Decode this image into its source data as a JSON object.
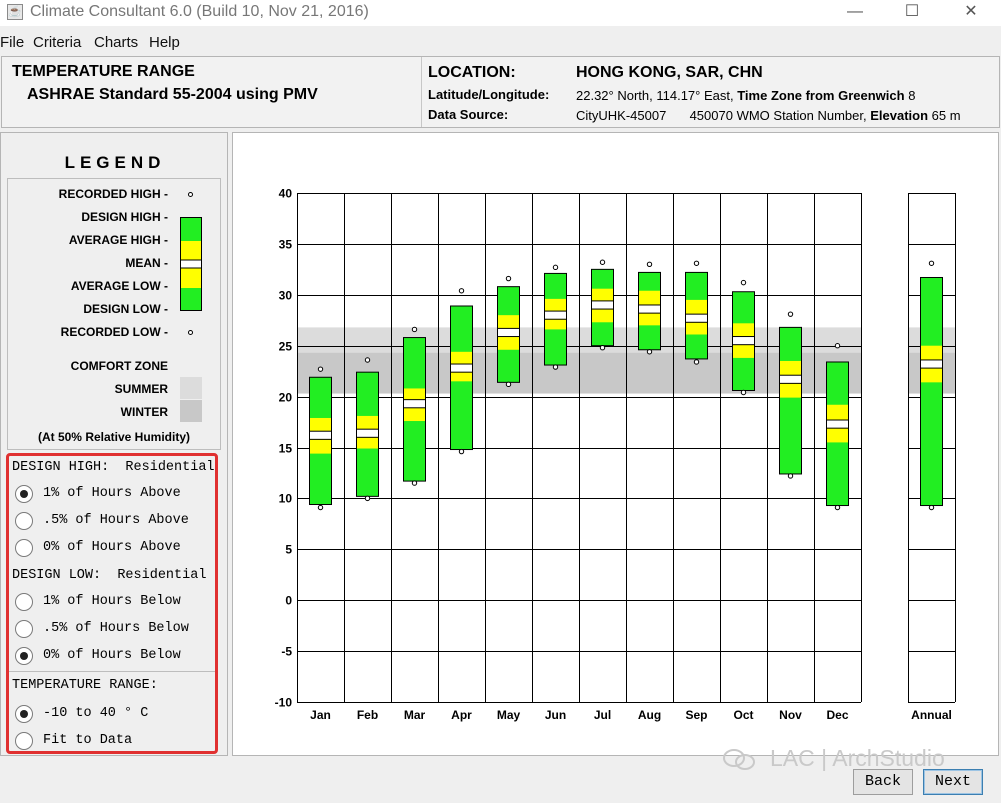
{
  "window": {
    "title": "Climate Consultant 6.0 (Build 10, Nov 21, 2016)",
    "controls": [
      "—",
      "☐",
      "✕"
    ]
  },
  "menu": [
    "File",
    "Criteria",
    "Charts",
    "Help"
  ],
  "header": {
    "chart_title": "TEMPERATURE RANGE",
    "chart_subtitle": "ASHRAE Standard 55-2004 using PMV",
    "location_label": "LOCATION:",
    "location_value": "HONG KONG, SAR, CHN",
    "latlon_label": "Latitude/Longitude:",
    "latlon_value": "22.32° North, 114.17° East,",
    "timezone_label": "Time Zone from Greenwich",
    "timezone_value": "8",
    "source_label": "Data Source:",
    "source_value": "CityUHK-45007",
    "station_value": "450070 WMO Station Number,",
    "elevation_label": "Elevation",
    "elevation_value": "65 m"
  },
  "legend": {
    "title": "LEGEND",
    "items": [
      "RECORDED HIGH -",
      "DESIGN HIGH -",
      "AVERAGE HIGH -",
      "MEAN -",
      "AVERAGE LOW -",
      "DESIGN LOW -",
      "RECORDED LOW -"
    ],
    "comfort_title": "COMFORT ZONE",
    "summer_label": "SUMMER",
    "winter_label": "WINTER",
    "note": "(At 50% Relative Humidity)",
    "colors": {
      "design_band": "#22ee22",
      "average_band": "#ffff00",
      "summer_zone": "#dcdcdc",
      "winter_zone": "#c8c8c8"
    }
  },
  "options": {
    "design_high_header": "DESIGN HIGH:  Residential",
    "design_high": [
      {
        "label": "1% of Hours Above",
        "selected": true
      },
      {
        "label": ".5% of Hours Above",
        "selected": false
      },
      {
        "label": "0% of Hours Above",
        "selected": false
      }
    ],
    "design_low_header": "DESIGN LOW:  Residential",
    "design_low": [
      {
        "label": "1% of Hours Below",
        "selected": false
      },
      {
        "label": ".5% of Hours Below",
        "selected": false
      },
      {
        "label": "0% of Hours Below",
        "selected": true
      }
    ],
    "range_header": "TEMPERATURE RANGE:",
    "range": [
      {
        "label": "-10 to 40 ° C",
        "selected": true
      },
      {
        "label": "Fit to Data",
        "selected": false
      }
    ]
  },
  "chart_data": {
    "type": "bar",
    "categories": [
      "Jan",
      "Feb",
      "Mar",
      "Apr",
      "May",
      "Jun",
      "Jul",
      "Aug",
      "Sep",
      "Oct",
      "Nov",
      "Dec",
      "Annual"
    ],
    "ylim": [
      -10,
      40
    ],
    "yticks": [
      40,
      35,
      30,
      25,
      20,
      15,
      10,
      5,
      0,
      -5,
      -10
    ],
    "grid": true,
    "comfort_zones": {
      "summer": [
        20.3,
        26.8
      ],
      "winter": [
        20.3,
        24.3
      ]
    },
    "data": [
      {
        "recorded_high": 22.5,
        "design_high": 21.9,
        "average_high": 17.9,
        "mean": 16.2,
        "average_low": 14.4,
        "design_low": 9.4,
        "recorded_low": 9.3
      },
      {
        "recorded_high": 23.4,
        "design_high": 22.4,
        "average_high": 18.1,
        "mean": 16.4,
        "average_low": 14.9,
        "design_low": 10.2,
        "recorded_low": 10.2
      },
      {
        "recorded_high": 26.4,
        "design_high": 25.8,
        "average_high": 20.8,
        "mean": 19.3,
        "average_low": 17.6,
        "design_low": 11.7,
        "recorded_low": 11.7
      },
      {
        "recorded_high": 30.2,
        "design_high": 28.9,
        "average_high": 24.4,
        "mean": 22.8,
        "average_low": 21.5,
        "design_low": 14.8,
        "recorded_low": 14.8
      },
      {
        "recorded_high": 31.4,
        "design_high": 30.8,
        "average_high": 28.0,
        "mean": 26.3,
        "average_low": 24.6,
        "design_low": 21.4,
        "recorded_low": 21.4
      },
      {
        "recorded_high": 32.5,
        "design_high": 32.1,
        "average_high": 29.6,
        "mean": 28.0,
        "average_low": 26.6,
        "design_low": 23.1,
        "recorded_low": 23.1
      },
      {
        "recorded_high": 33.0,
        "design_high": 32.5,
        "average_high": 30.6,
        "mean": 29.0,
        "average_low": 27.3,
        "design_low": 25.0,
        "recorded_low": 25.0
      },
      {
        "recorded_high": 32.8,
        "design_high": 32.2,
        "average_high": 30.4,
        "mean": 28.6,
        "average_low": 27.0,
        "design_low": 24.6,
        "recorded_low": 24.6
      },
      {
        "recorded_high": 32.9,
        "design_high": 32.2,
        "average_high": 29.5,
        "mean": 27.7,
        "average_low": 26.1,
        "design_low": 23.7,
        "recorded_low": 23.6
      },
      {
        "recorded_high": 31.0,
        "design_high": 30.3,
        "average_high": 27.2,
        "mean": 25.5,
        "average_low": 23.8,
        "design_low": 20.6,
        "recorded_low": 20.6
      },
      {
        "recorded_high": 27.9,
        "design_high": 26.8,
        "average_high": 23.5,
        "mean": 21.7,
        "average_low": 19.9,
        "design_low": 12.4,
        "recorded_low": 12.4
      },
      {
        "recorded_high": 24.8,
        "design_high": 23.4,
        "average_high": 19.2,
        "mean": 17.3,
        "average_low": 15.5,
        "design_low": 9.3,
        "recorded_low": 9.3
      },
      {
        "recorded_high": 32.9,
        "design_high": 31.7,
        "average_high": 25.0,
        "mean": 23.2,
        "average_low": 21.4,
        "design_low": 9.3,
        "recorded_low": 9.3
      }
    ]
  },
  "footer": {
    "back_label": "Back",
    "next_label": "Next"
  },
  "watermark": "LAC | ArchStudio"
}
